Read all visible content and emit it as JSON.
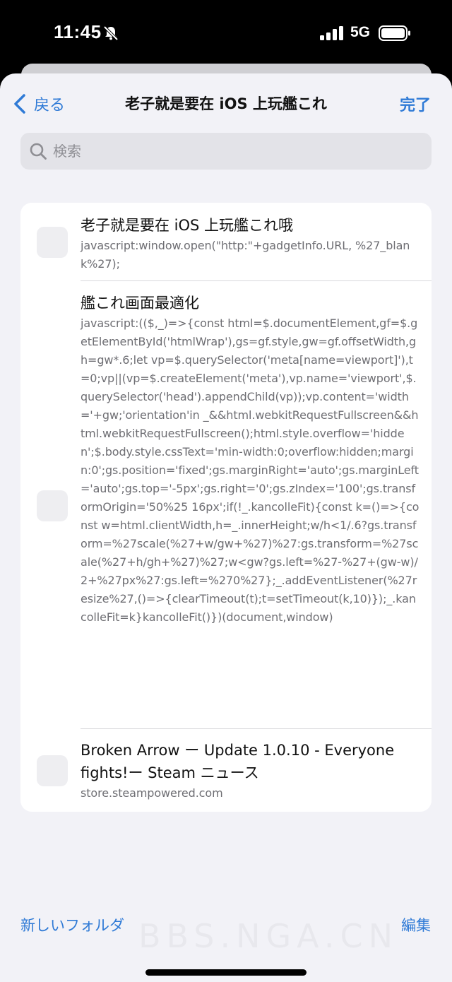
{
  "status_bar": {
    "time": "11:45",
    "network": "5G"
  },
  "nav": {
    "back_label": "戻る",
    "title": "老子就是要在 iOS 上玩艦これ",
    "done_label": "完了"
  },
  "search": {
    "placeholder": "検索"
  },
  "items": [
    {
      "title": "老子就是要在 iOS 上玩艦これ哦",
      "subtitle": "javascript:window.open(\"http:\"+gadgetInfo.URL, %27_blank%27);"
    },
    {
      "title": "艦これ画面最適化",
      "subtitle": "javascript:(($,_)=>{const html=$.documentElement,gf=$.getElementById('htmlWrap'),gs=gf.style,gw=gf.offsetWidth,gh=gw*.6;let vp=$.querySelector('meta[name=viewport]'),t=0;vp||(vp=$.createElement('meta'),vp.name='viewport',$.querySelector('head').appendChild(vp));vp.content='width='+gw;'orientation'in _&&html.webkitRequestFullscreen&&html.webkitRequestFullscreen();html.style.overflow='hidden';$.body.style.cssText='min-width:0;overflow:hidden;margin:0';gs.position='fixed';gs.marginRight='auto';gs.marginLeft='auto';gs.top='-5px';gs.right='0';gs.zIndex='100';gs.transformOrigin='50%25 16px';if(!_.kancolleFit){const k=()=>{const w=html.clientWidth,h=_.innerHeight;w/h<1/.6?gs.transform=%27scale(%27+w/gw+%27)%27:gs.transform=%27scale(%27+h/gh+%27)%27;w<gw?gs.left=%27-%27+(gw-w)/2+%27px%27:gs.left=%270%27};_.addEventListener(%27resize%27,()=>{clearTimeout(t);t=setTimeout(k,10)});_.kancolleFit=k}kancolleFit()})(document,window)"
    },
    {
      "title": "Broken Arrow ー Update 1.0.10 - Everyone fights!ー Steam ニュース",
      "subtitle": "store.steampowered.com"
    }
  ],
  "bottom": {
    "new_folder_label": "新しいフォルダ",
    "edit_label": "編集"
  },
  "watermark": "BBS.NGA.CN",
  "colors": {
    "accent": "#2f7ad6",
    "background": "#f2f2f7"
  },
  "icons": {
    "back": "chevron-left-icon",
    "search": "magnifier-icon",
    "silent": "bell-slash-icon",
    "signal": "cellular-signal-icon",
    "battery": "battery-icon"
  }
}
